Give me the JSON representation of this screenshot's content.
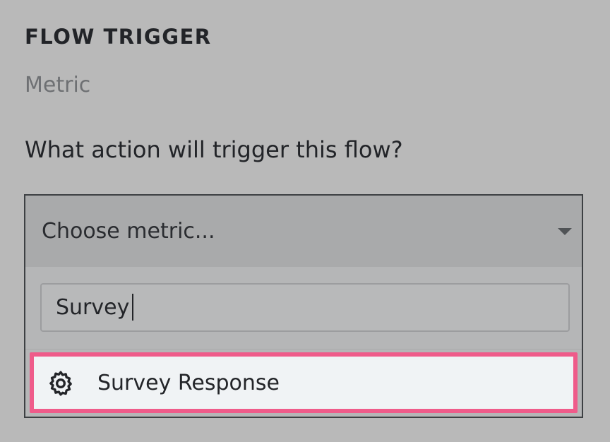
{
  "section": {
    "title": "FLOW TRIGGER",
    "trigger_type": "Metric",
    "question": "What action will trigger this flow?"
  },
  "dropdown": {
    "placeholder": "Choose metric...",
    "search_value": "Survey",
    "options": [
      {
        "label": "Survey Response",
        "icon": "gear-icon",
        "highlighted": true
      }
    ]
  },
  "colors": {
    "background": "#b9b9b9",
    "highlight_border": "#ef5b8a",
    "option_background": "#f0f3f5",
    "text_primary": "#232529",
    "text_secondary": "#6e7073"
  }
}
